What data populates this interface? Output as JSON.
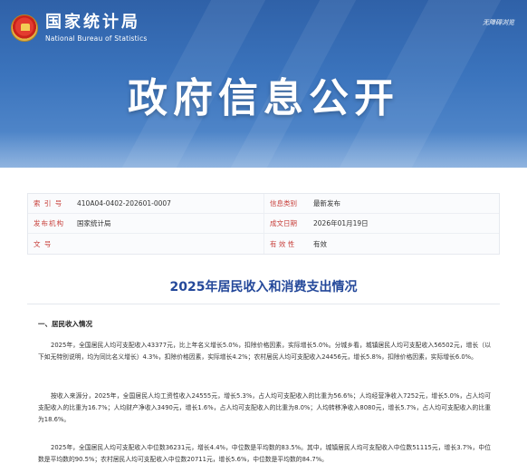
{
  "header": {
    "logo_cn": "国家统计局",
    "logo_en": "National Bureau of Statistics",
    "accessible_label": "无障碍浏览",
    "banner_title": "政府信息公开"
  },
  "meta": {
    "index_label": "索 引 号",
    "index_value": "410A04-0402-202601-0007",
    "category_label": "信息类别",
    "category_value": "最新发布",
    "publisher_label": "发布机构",
    "publisher_value": "国家统计局",
    "date_label": "成文日期",
    "date_value": "2026年01月19日",
    "docno_label": "文 号",
    "docno_value": "",
    "validity_label": "有 效 性",
    "validity_value": "有效"
  },
  "article": {
    "title": "2025年居民收入和消费支出情况",
    "section1_heading": "一、居民收入情况",
    "p1": "2025年，全国居民人均可支配收入43377元，比上年名义增长5.0%，扣除价格因素，实际增长5.0%。分城乡看，城镇居民人均可支配收入56502元，增长（以下如无特别说明，均为同比名义增长）4.3%，扣除价格因素，实际增长4.2%；农村居民人均可支配收入24456元，增长5.8%，扣除价格因素，实际增长6.0%。",
    "p2": "按收入来源分，2025年，全国居民人均工资性收入24555元，增长5.3%，占人均可支配收入的比重为56.6%；人均经营净收入7252元，增长5.0%，占人均可支配收入的比重为16.7%；人均财产净收入3490元，增长1.6%，占人均可支配收入的比重为8.0%；人均转移净收入8080元，增长5.7%，占人均可支配收入的比重为18.6%。",
    "p3": "2025年，全国居民人均可支配收入中位数36231元，增长4.4%，中位数是平均数的83.5%。其中，城镇居民人均可支配收入中位数51115元，增长3.7%，中位数是平均数的90.5%；农村居民人均可支配收入中位数20711元，增长5.6%，中位数是平均数的84.7%。"
  },
  "colors": {
    "banner_top": "#2f61a8",
    "label_red": "#c8413c",
    "title_blue": "#24489a"
  }
}
